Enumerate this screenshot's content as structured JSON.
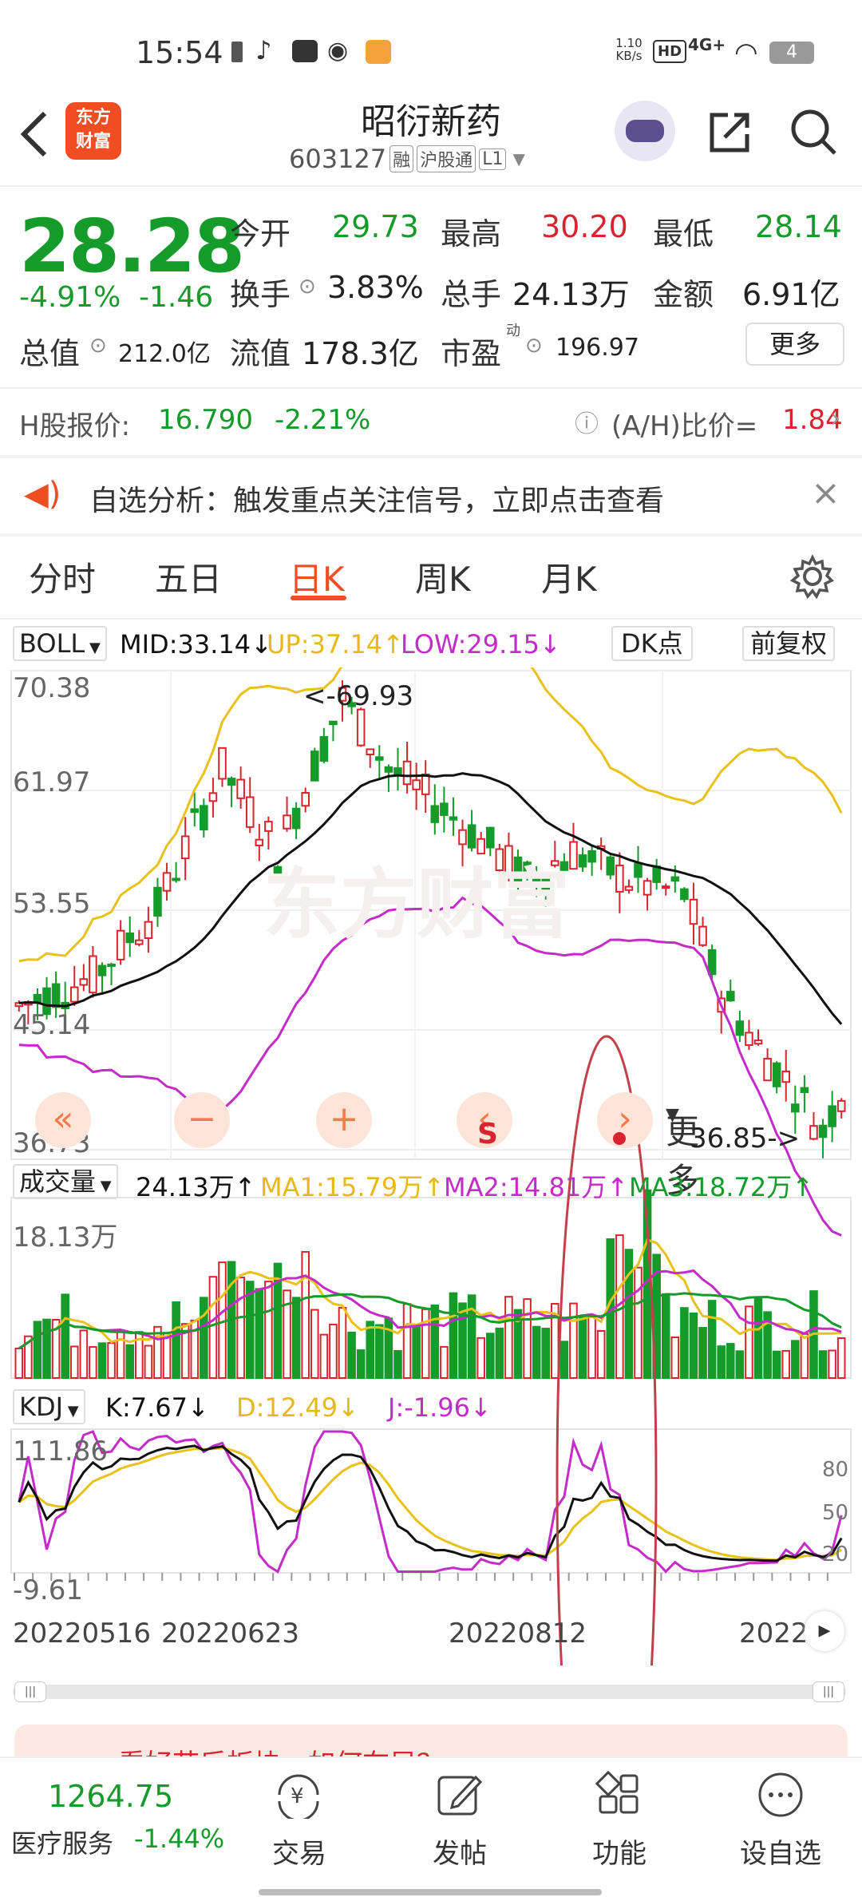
{
  "status": {
    "time": "15:54",
    "net_speed": "1.10\nKB/s",
    "net_speed_a": "1.10",
    "net_speed_b": "KB/s",
    "hd": "HD",
    "signal": "4G+",
    "battery": "4"
  },
  "header": {
    "logo_line1": "东方",
    "logo_line2": "财富",
    "title": "昭衍新药",
    "code": "603127",
    "tag1": "融",
    "tag2": "沪股通",
    "tag3": "L1"
  },
  "quote": {
    "price": "28.28",
    "change_pct": "-4.91%",
    "change": "-1.46",
    "open_label": "今开",
    "open": "29.73",
    "high_label": "最高",
    "high": "30.20",
    "low_label": "最低",
    "low": "28.14",
    "turnover_label": "换手",
    "turnover": "3.83%",
    "volume_label": "总手",
    "volume": "24.13万",
    "amount_label": "金额",
    "amount": "6.91亿",
    "mcap_label": "总值",
    "mcap": "212.0亿",
    "float_label": "流值",
    "float": "178.3亿",
    "pe_label": "市盈",
    "pe_sup": "动",
    "pe": "196.97",
    "more": "更多"
  },
  "hshare": {
    "label": "H股报价:",
    "price": "16.790",
    "pct": "-2.21%",
    "ratio_label": "(A/H)比价=",
    "ratio": "1.84"
  },
  "notice": {
    "text": "自选分析：触发重点关注信号，立即点击查看"
  },
  "tabs": [
    "分时",
    "五日",
    "日K",
    "周K",
    "月K",
    "更多"
  ],
  "active_tab": "日K",
  "boll": {
    "name": "BOLL",
    "mid": "MID:33.14",
    "up": "UP:37.14",
    "low": "LOW:29.15",
    "dk": "DK点",
    "fq": "前复权",
    "y_ticks": [
      "70.38",
      "61.97",
      "53.55",
      "45.14",
      "36.73"
    ],
    "max_label": "<-69.93",
    "min_label": "36.85->",
    "watermark": "东方财富"
  },
  "vol": {
    "name": "成交量",
    "value": "24.13万",
    "ma1": "MA1:15.79万",
    "ma2": "MA2:14.81万",
    "ma3": "MA3:18.72万",
    "y_top": "18.13万"
  },
  "kdj": {
    "name": "KDJ",
    "k": "K:7.67",
    "d": "D:12.49",
    "j": "J:-1.96",
    "y_top": "111.86",
    "y_bottom": "-9.61",
    "r80": "80",
    "r50": "50",
    "r20": "20"
  },
  "dates": [
    "20220516",
    "20220623",
    "20220812",
    "2022"
  ],
  "banner": {
    "text": "看好节后板块，如何布局？"
  },
  "bottom": {
    "index_value": "1264.75",
    "index_name": "医疗服务",
    "index_pct": "-1.44%",
    "trade": "交易",
    "post": "发帖",
    "func": "功能",
    "fav": "设自选"
  },
  "colors": {
    "up": "#d8242f",
    "down": "#159b2a",
    "mid": "#111111",
    "upper": "#e8c21a",
    "lower": "#c42bc9",
    "accent": "#f04d23"
  }
}
